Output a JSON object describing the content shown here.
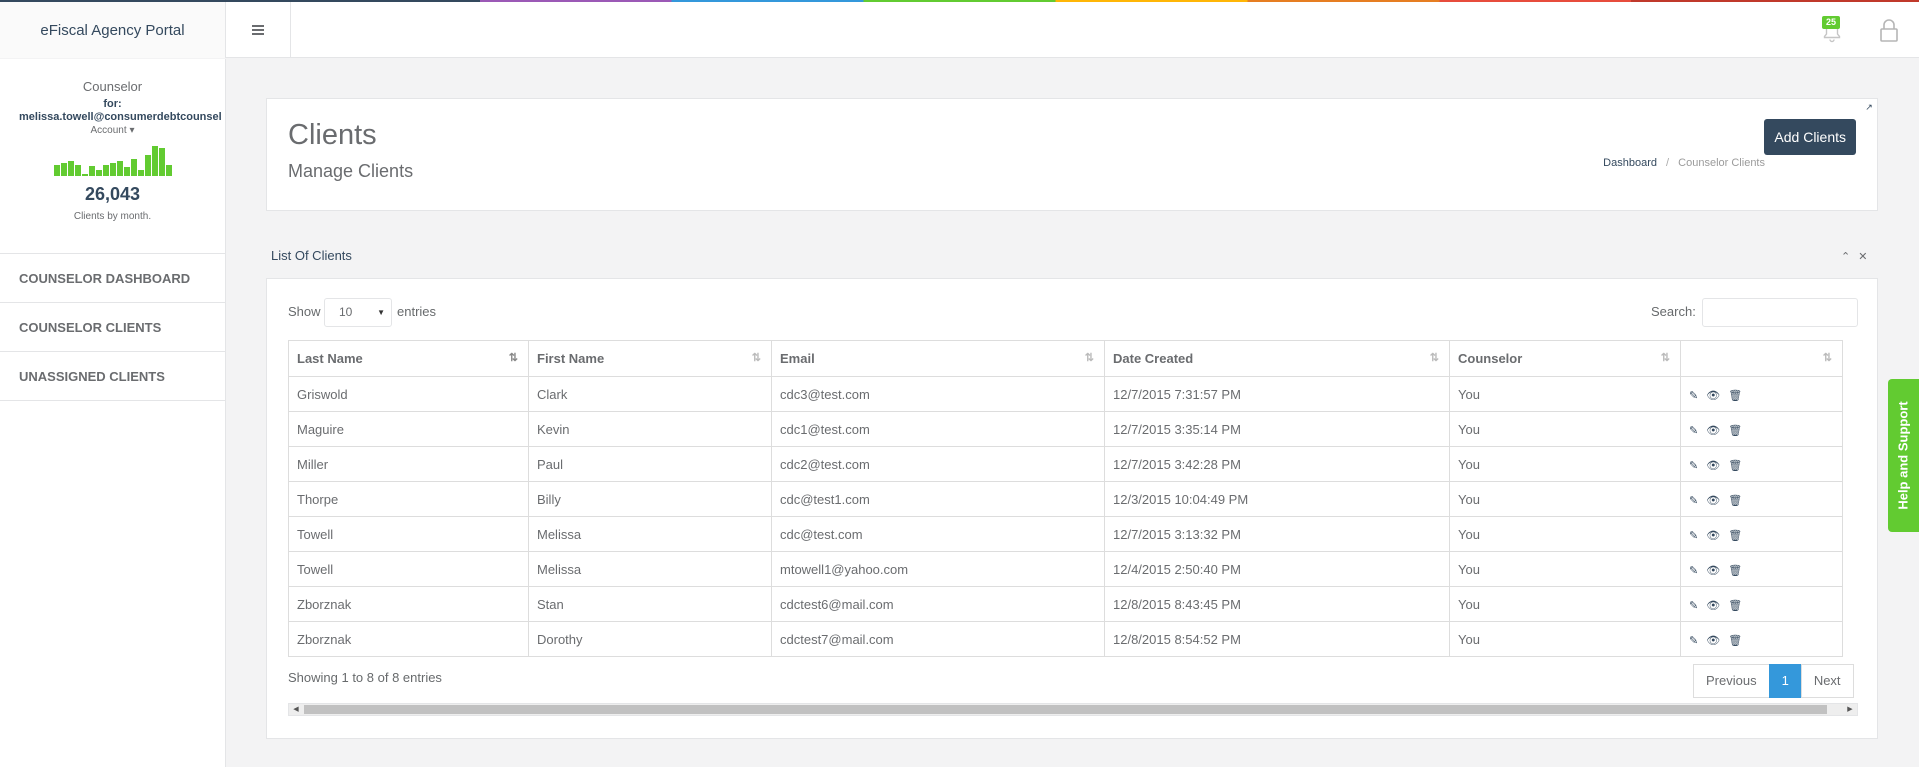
{
  "header": {
    "brand": "eFiscal Agency Portal",
    "notification_count": "25"
  },
  "sidebar": {
    "role": "Counselor",
    "for_label": "for:",
    "email": "melissa.towell@consumerdebtcounsel",
    "account_label": "Account",
    "sparkline": [
      10,
      12,
      14,
      10,
      2,
      9,
      6,
      10,
      12,
      14,
      8,
      16,
      6,
      20,
      28,
      26,
      10
    ],
    "count": "26,043",
    "count_label": "Clients by month.",
    "nav": [
      {
        "label": "COUNSELOR DASHBOARD"
      },
      {
        "label": "COUNSELOR CLIENTS"
      },
      {
        "label": "UNASSIGNED CLIENTS"
      }
    ]
  },
  "page_header": {
    "title": "Clients",
    "subtitle": "Manage Clients",
    "add_button": "Add Clients",
    "breadcrumb": {
      "home": "Dashboard",
      "sep": "/",
      "current": "Counselor Clients"
    }
  },
  "list": {
    "title": "List Of Clients",
    "show_label": "Show",
    "page_size": "10",
    "entries_label": "entries",
    "search_label": "Search:",
    "columns": [
      "Last Name",
      "First Name",
      "Email",
      "Date Created",
      "Counselor",
      ""
    ],
    "rows": [
      {
        "last": "Griswold",
        "first": "Clark",
        "email": "cdc3@test.com",
        "date": "12/7/2015 7:31:57 PM",
        "counselor": "You"
      },
      {
        "last": "Maguire",
        "first": "Kevin",
        "email": "cdc1@test.com",
        "date": "12/7/2015 3:35:14 PM",
        "counselor": "You"
      },
      {
        "last": "Miller",
        "first": "Paul",
        "email": "cdc2@test.com",
        "date": "12/7/2015 3:42:28 PM",
        "counselor": "You"
      },
      {
        "last": "Thorpe",
        "first": "Billy",
        "email": "cdc@test1.com",
        "date": "12/3/2015 10:04:49 PM",
        "counselor": "You"
      },
      {
        "last": "Towell",
        "first": "Melissa",
        "email": "cdc@test.com",
        "date": "12/7/2015 3:13:32 PM",
        "counselor": "You"
      },
      {
        "last": "Towell",
        "first": "Melissa",
        "email": "mtowell1@yahoo.com",
        "date": "12/4/2015 2:50:40 PM",
        "counselor": "You"
      },
      {
        "last": "Zborznak",
        "first": "Stan",
        "email": "cdctest6@mail.com",
        "date": "12/8/2015 8:43:45 PM",
        "counselor": "You"
      },
      {
        "last": "Zborznak",
        "first": "Dorothy",
        "email": "cdctest7@mail.com",
        "date": "12/8/2015 8:54:52 PM",
        "counselor": "You"
      }
    ],
    "info": "Showing 1 to 8 of 8 entries",
    "pager": {
      "previous": "Previous",
      "current": "1",
      "next": "Next"
    }
  },
  "help_tab": "Help and Support",
  "colors": {
    "accent_green": "#62cb31",
    "navy": "#34495e",
    "pager_blue": "#3498db"
  }
}
